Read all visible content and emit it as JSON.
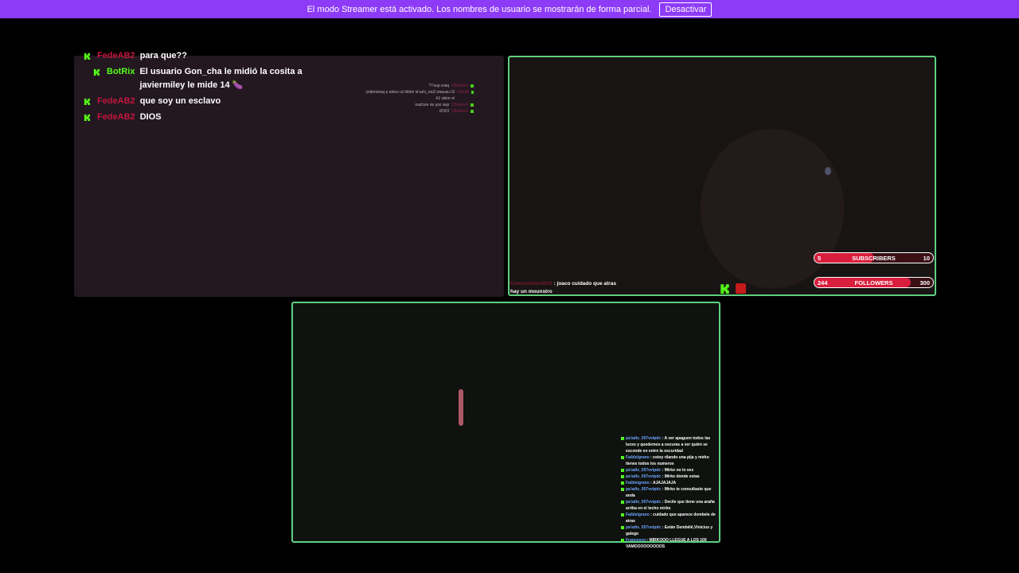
{
  "banner": {
    "message": "El modo Streamer está activado. Los nombres de usuario se mostrarán de forma parcial.",
    "button_label": "Desactivar"
  },
  "chat": {
    "messages": [
      {
        "user": "FedeAB2",
        "text": "para que??",
        "bot": false
      },
      {
        "user": "BotRix",
        "text": "El usuario Gon_cha le midió la cosita a javiermiley le mide 14 🍆",
        "bot": true
      },
      {
        "user": "FedeAB2",
        "text": "que soy un esclavo",
        "bot": false
      },
      {
        "user": "FedeAB2",
        "text": "DIOS",
        "bot": false
      }
    ]
  },
  "mirror_chat": {
    "rows": [
      {
        "user": "FedeAB2",
        "text": "para que??"
      },
      {
        "user": "BotRix",
        "text": "El usuario Gon_cha le midió la cosita a javiermiley le mide 14"
      },
      {
        "user": "FedeAB2",
        "text": "que soy un esclavo"
      },
      {
        "user": "FedeAB2",
        "text": "DIOS"
      }
    ]
  },
  "overlay": {
    "subscribers": {
      "label": "SUBSCRIBERS",
      "current": "5",
      "goal": "10",
      "progress": 0.5
    },
    "followers": {
      "label": "FOLLOWERS",
      "current": "244",
      "goal": "300",
      "progress": 0.81
    },
    "chat_line": {
      "user": "Consumidor2012",
      "text": ": joaco cuidado que atras hay un mounstro"
    }
  },
  "feed": {
    "rows": [
      {
        "user": "pa'adis_057vvtpdc",
        "text": ": A ver apaguen todos las luces y quedemos a oscuras a ver quién se esconde en entre la oscuridad"
      },
      {
        "user": "Faiblelgrano",
        "text": ": estoy rilando una pija y mirko tienes todos los numeros"
      },
      {
        "user": "pa'adis_057vvtpdc",
        "text": ": Mirko no lo ves"
      },
      {
        "user": "pa'adis_057vvtpdc",
        "text": ": Mirko donde estas"
      },
      {
        "user": "Faiblelgrano",
        "text": ": AJAJAJAJA"
      },
      {
        "user": "pa'adis_057vvtpdc",
        "text": ": Mirko te consultaste que anda"
      },
      {
        "user": "pa'adis_057vvtpdc",
        "text": ": Decile que tiene una araña arriba en el techo mirko"
      },
      {
        "user": "Faiblelgrano",
        "text": ": cuidado que aparece dembele de atras"
      },
      {
        "user": "pa'adis_057vvtpdc",
        "text": ": Están Dembélé,Vinicius y galego"
      },
      {
        "user": "Francesyo",
        "text": ": MIRKOOO LLEGUE A LOS 100 VAMOOOOOOOOOS"
      }
    ]
  }
}
